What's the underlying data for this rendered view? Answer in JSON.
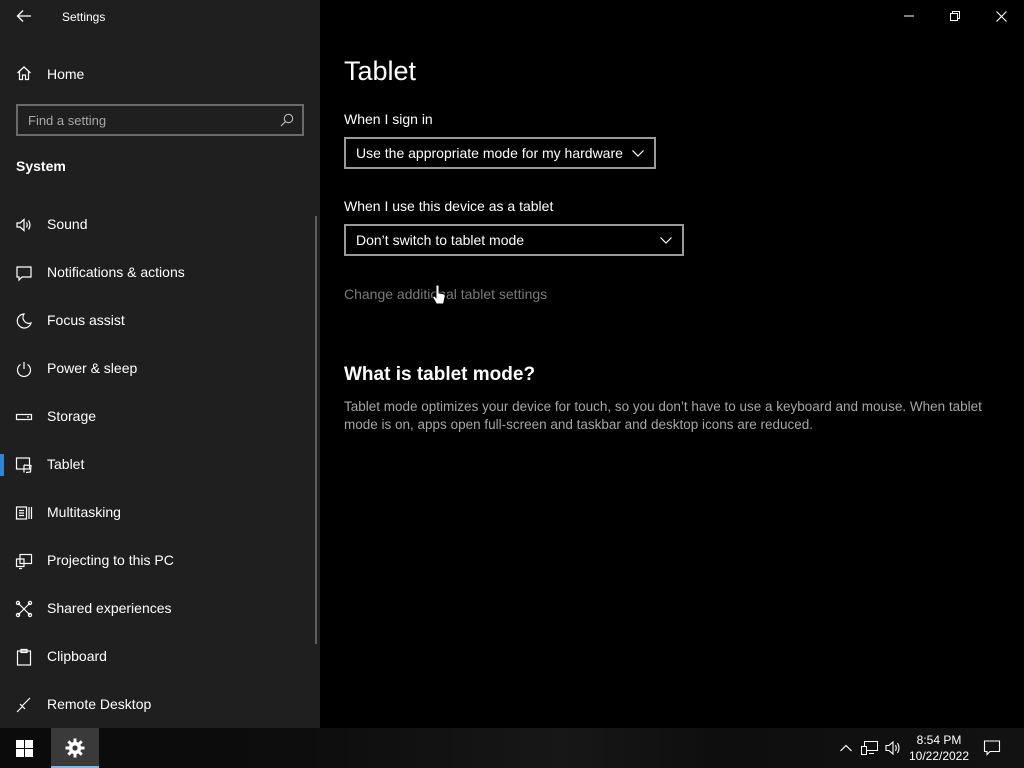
{
  "window": {
    "title": "Settings"
  },
  "sidebar": {
    "home_label": "Home",
    "search_placeholder": "Find a setting",
    "section_label": "System",
    "items": [
      {
        "label": "Sound",
        "icon": "speaker-icon",
        "selected": false
      },
      {
        "label": "Notifications & actions",
        "icon": "message-icon",
        "selected": false
      },
      {
        "label": "Focus assist",
        "icon": "moon-icon",
        "selected": false
      },
      {
        "label": "Power & sleep",
        "icon": "power-icon",
        "selected": false
      },
      {
        "label": "Storage",
        "icon": "storage-icon",
        "selected": false
      },
      {
        "label": "Tablet",
        "icon": "tablet-icon",
        "selected": true
      },
      {
        "label": "Multitasking",
        "icon": "multitasking-icon",
        "selected": false
      },
      {
        "label": "Projecting to this PC",
        "icon": "projector-icon",
        "selected": false
      },
      {
        "label": "Shared experiences",
        "icon": "shared-icon",
        "selected": false
      },
      {
        "label": "Clipboard",
        "icon": "clipboard-icon",
        "selected": false
      },
      {
        "label": "Remote Desktop",
        "icon": "remote-icon",
        "selected": false
      }
    ]
  },
  "main": {
    "title": "Tablet",
    "sign_in_label": "When I sign in",
    "sign_in_value": "Use the appropriate mode for my hardware",
    "tablet_use_label": "When I use this device as a tablet",
    "tablet_use_value": "Don’t switch to tablet mode",
    "change_link": "Change additional tablet settings",
    "what_heading": "What is tablet mode?",
    "what_desc": "Tablet mode optimizes your device for touch, so you don’t have to use a keyboard and mouse. When tablet mode is on, apps open full-screen and taskbar and desktop icons are reduced."
  },
  "taskbar": {
    "time": "8:54 PM",
    "date": "10/22/2022"
  },
  "colors": {
    "accent": "#2b88d8",
    "sidebar_bg": "#1f1f1f",
    "main_bg": "#000000"
  }
}
